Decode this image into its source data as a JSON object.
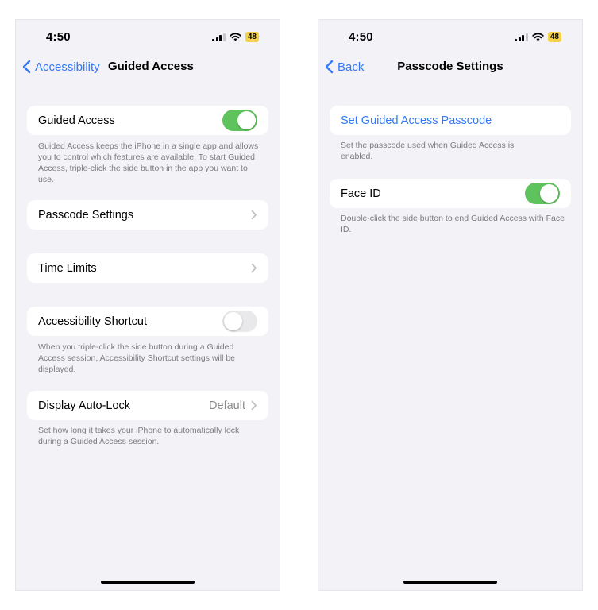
{
  "left": {
    "status": {
      "time": "4:50",
      "battery": "48"
    },
    "nav": {
      "back_label": "Accessibility",
      "title": "Guided Access"
    },
    "guided_access": {
      "label": "Guided Access",
      "enabled": true,
      "footer": "Guided Access keeps the iPhone in a single app and allows you to control which features are available. To start Guided Access, triple-click the side button in the app you want to use."
    },
    "passcode_settings": {
      "label": "Passcode Settings"
    },
    "time_limits": {
      "label": "Time Limits"
    },
    "accessibility_shortcut": {
      "label": "Accessibility Shortcut",
      "enabled": false,
      "footer": "When you triple-click the side button during a Guided Access session, Accessibility Shortcut settings will be displayed."
    },
    "display_auto_lock": {
      "label": "Display Auto-Lock",
      "value": "Default",
      "footer": "Set how long it takes your iPhone to automatically lock during a Guided Access session."
    }
  },
  "right": {
    "status": {
      "time": "4:50",
      "battery": "48"
    },
    "nav": {
      "back_label": "Back",
      "title": "Passcode Settings"
    },
    "set_passcode": {
      "label": "Set Guided Access Passcode",
      "footer": "Set the passcode used when Guided Access is enabled."
    },
    "face_id": {
      "label": "Face ID",
      "enabled": true,
      "footer": "Double-click the side button to end Guided Access with Face ID."
    }
  },
  "colors": {
    "accent": "#3478f6",
    "toggle_on": "#5fc35d",
    "toggle_off": "#e9e9eb",
    "background": "#f2f2f7",
    "battery": "#f4d34a"
  }
}
